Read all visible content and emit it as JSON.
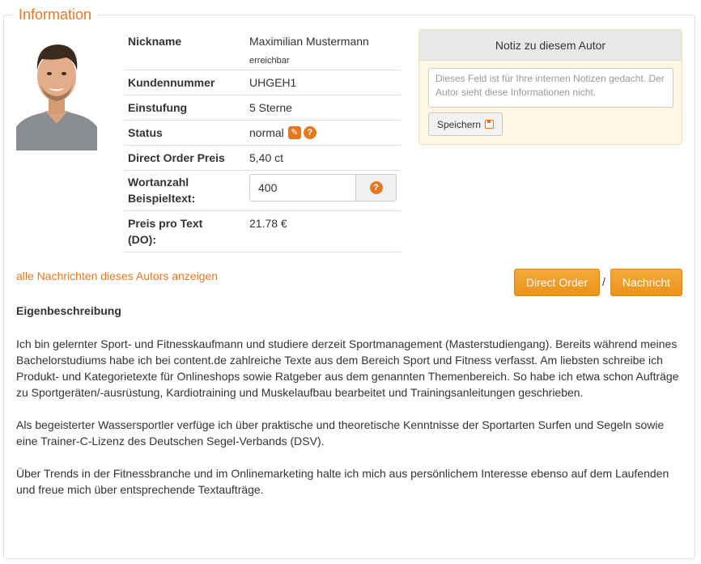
{
  "section": {
    "legend": "Information"
  },
  "author": {
    "nickname_label": "Nickname",
    "nickname": "Maximilian Mustermann",
    "availability": "erreichbar",
    "customer_no_label": "Kundennummer",
    "customer_no": "UHGEH1",
    "rating_label": "Einstufung",
    "rating": "5 Sterne",
    "status_label": "Status",
    "status": "normal",
    "direct_price_label": "Direct Order Preis",
    "direct_price": "5,40 ct",
    "word_count_label_line1": "Wortanzahl",
    "word_count_label_line2": "Beispieltext:",
    "word_count": "400",
    "price_per_text_label_line1": "Preis pro Text",
    "price_per_text_label_line2": "(DO):",
    "price_per_text": "21.78 €"
  },
  "note": {
    "title": "Notiz zu diesem Autor",
    "placeholder": "Dieses Feld ist für Ihre internen Notizen gedacht. Der Autor sieht diese Informationen nicht.",
    "save_label": "Speichern"
  },
  "actions": {
    "all_messages_link": "alle Nachrichten dieses Autors anzeigen",
    "direct_order_label": "Direct Order",
    "separator": "/",
    "message_label": "Nachricht"
  },
  "description": {
    "title": "Eigenbeschreibung",
    "paragraphs": [
      "Ich bin gelernter Sport- und Fitnesskaufmann und studiere derzeit Sportmanagement (Masterstudiengang). Bereits während meines Bachelorstudiums habe ich bei content.de zahlreiche Texte aus dem Bereich Sport und Fitness verfasst. Am liebsten schreibe ich Produkt- und Kategorietexte für Onlineshops sowie Ratgeber aus dem genannten Themenbereich. So habe ich etwa schon Aufträge zu Sportgeräten/-ausrüstung, Kardiotraining und Muskelaufbau bearbeitet und Trainingsanleitungen geschrieben.",
      "Als begeisterter Wassersportler verfüge ich über praktische und theoretische Kenntnisse der Sportarten Surfen und Segeln sowie eine Trainer-C-Lizenz des Deutschen Segel-Verbands (DSV).",
      "Über Trends in der Fitnessbranche und im Onlinemarketing halte ich mich aus persönlichem Interesse ebenso auf dem Laufenden und freue mich über entsprechende Textaufträge."
    ]
  },
  "colors": {
    "accent": "#e87722",
    "button_orange": "#f0a22b",
    "available_green": "#2e8b2e"
  },
  "icons": {
    "edit": "pencil-icon",
    "help": "question-icon",
    "save": "floppy-disk-icon"
  }
}
